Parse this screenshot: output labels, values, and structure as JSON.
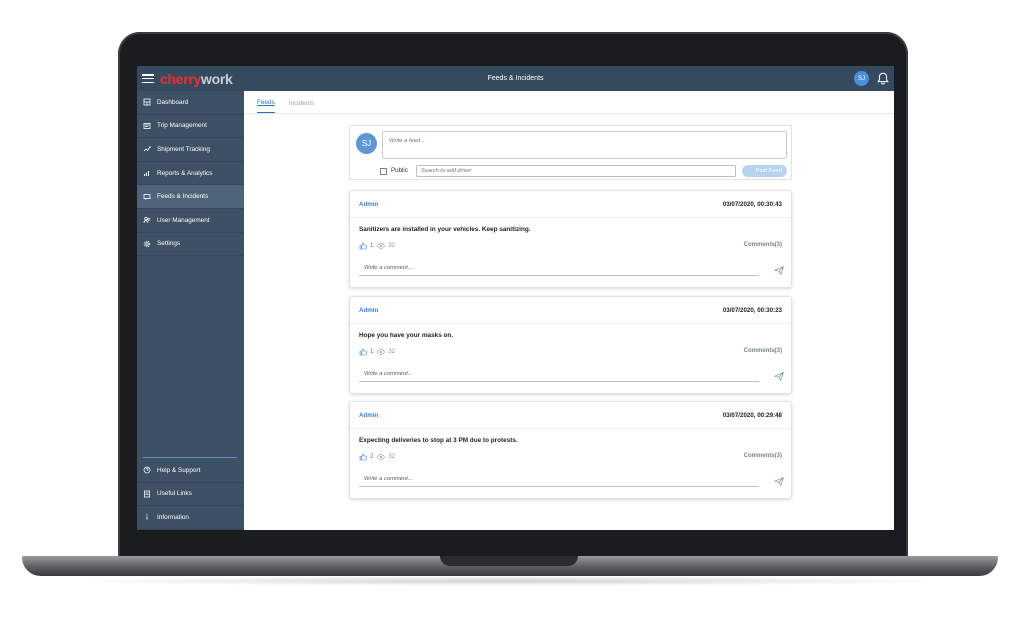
{
  "app": {
    "logo_part1": "cherry",
    "logo_part2": "work",
    "title": "Feeds & Incidents",
    "user_initials": "SJ"
  },
  "sidebar": {
    "items": [
      {
        "label": "Dashboard",
        "icon": "dashboard-icon"
      },
      {
        "label": "Trip Management",
        "icon": "trip-icon"
      },
      {
        "label": "Shipment Tracking",
        "icon": "shipment-icon"
      },
      {
        "label": "Reports & Analytics",
        "icon": "chart-icon"
      },
      {
        "label": "Feeds & Incidents",
        "icon": "feed-icon",
        "active": true
      },
      {
        "label": "User Management",
        "icon": "users-icon"
      },
      {
        "label": "Settings",
        "icon": "gear-icon"
      }
    ],
    "bottom_items": [
      {
        "label": "Help & Support",
        "icon": "help-icon"
      },
      {
        "label": "Useful Links",
        "icon": "links-icon"
      },
      {
        "label": "Information",
        "icon": "info-icon"
      }
    ]
  },
  "tabs": [
    {
      "label": "Feeds",
      "active": true
    },
    {
      "label": "Incidents",
      "active": false
    }
  ],
  "composer": {
    "avatar": "SJ",
    "feed_placeholder": "Write a feed...",
    "public_label": "Public",
    "driver_placeholder": "Search to add driver",
    "post_label": "Post Feed"
  },
  "feeds": [
    {
      "author": "Admin",
      "timestamp": "03/07/2020, 00:30:43",
      "message": "Sanitizers are installed in your vehicles. Keep sanitizing.",
      "likes": "1",
      "views": "32",
      "comments": "Comments(3)",
      "comment_placeholder": "Write a comment..."
    },
    {
      "author": "Admin",
      "timestamp": "03/07/2020, 00:30:23",
      "message": "Hope you have your masks on.",
      "likes": "1",
      "views": "32",
      "comments": "Comments(3)",
      "comment_placeholder": "Write a comment..."
    },
    {
      "author": "Admin",
      "timestamp": "03/07/2020, 00:29:48",
      "message": "Expecting deliveries to stop at 3 PM due to protests.",
      "likes": "2",
      "views": "32",
      "comments": "Comments(3)",
      "comment_placeholder": "Write a comment..."
    }
  ],
  "colors": {
    "topbar": "#354a5f",
    "sidebar": "#3d5064",
    "accent": "#3b7fd0",
    "logo_red": "#e8322f"
  }
}
